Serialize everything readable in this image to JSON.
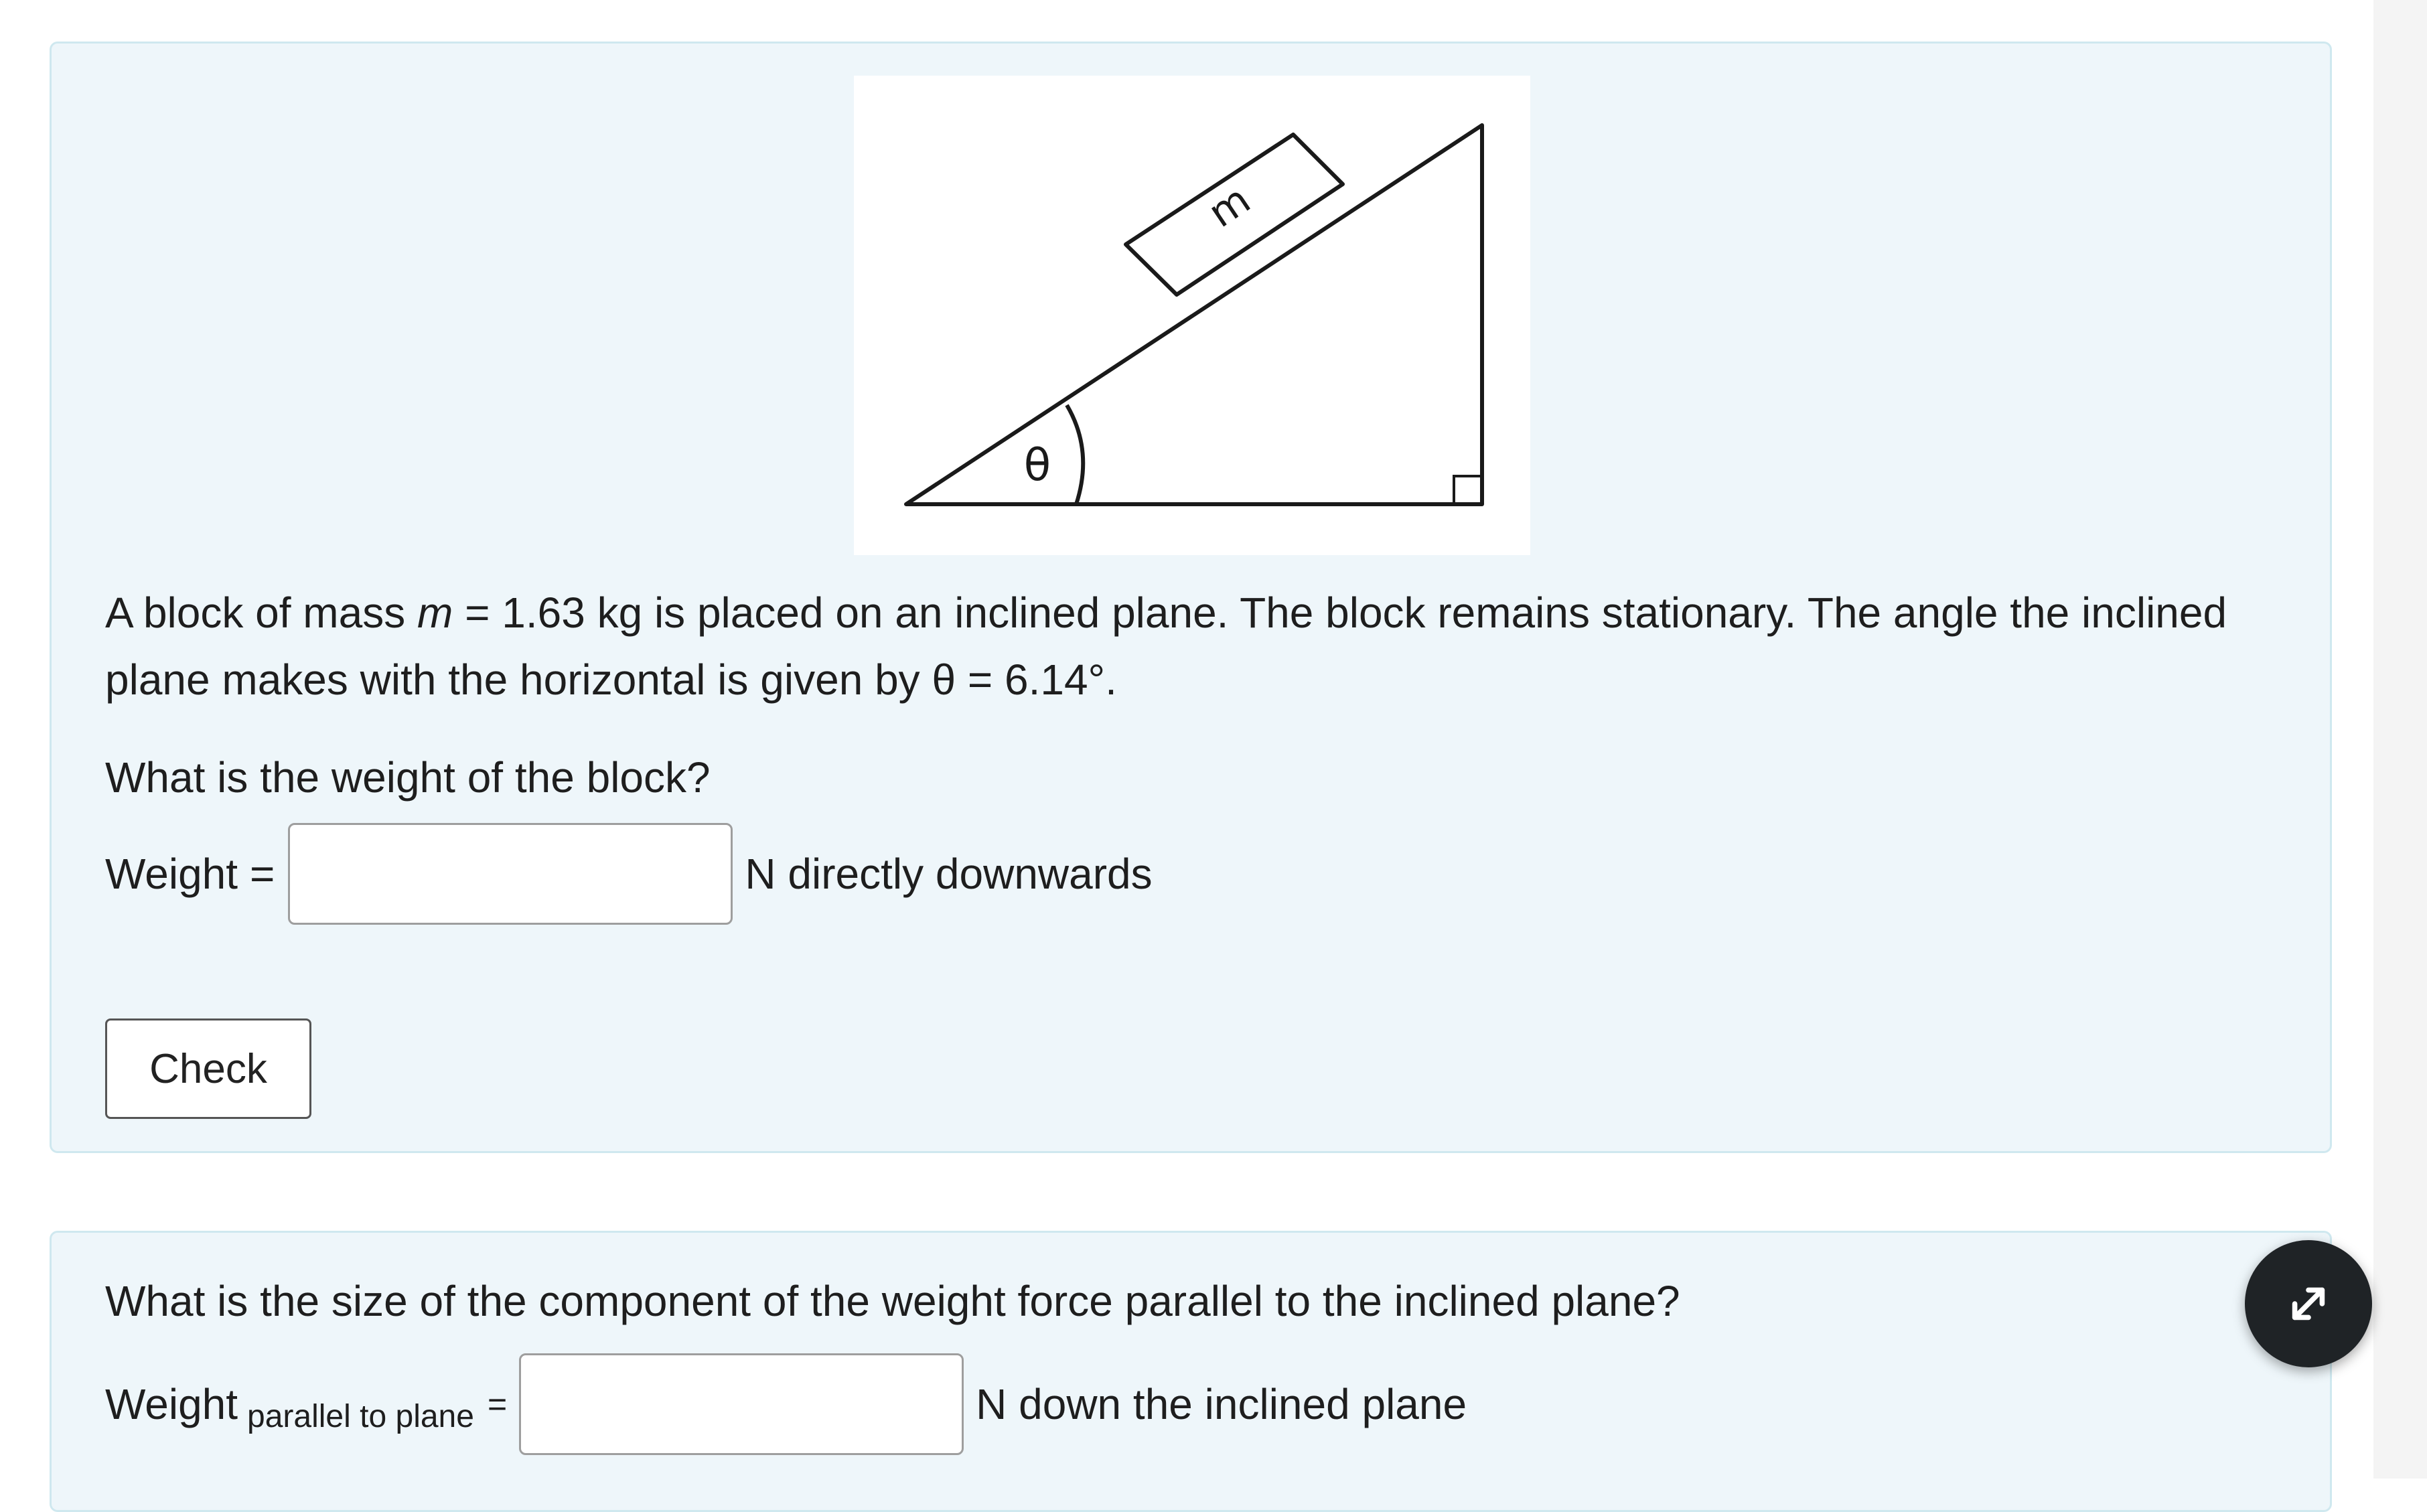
{
  "question1": {
    "diagram": {
      "block_label": "m",
      "angle_label": "θ"
    },
    "statement": {
      "part1": "A block of mass ",
      "mass_symbol": "m",
      "part2": " = 1.63 kg is placed on an inclined plane. The block remains stationary. The angle the inclined",
      "line2": "plane makes with the horizontal is given by θ = 6.14°."
    },
    "question": "What is the weight of the block?",
    "answer_label": "Weight",
    "answer_equals": "=",
    "answer_value": "",
    "answer_unit": "N directly downwards",
    "check_label": "Check"
  },
  "question2": {
    "question": "What is the size of the component of the weight force parallel to the inclined plane?",
    "answer_label": "Weight",
    "answer_subscript": "parallel to plane",
    "answer_equals": "=",
    "answer_value": "",
    "answer_unit": "N down the inclined plane"
  },
  "fab": {
    "icon": "expand-arrows-icon"
  }
}
